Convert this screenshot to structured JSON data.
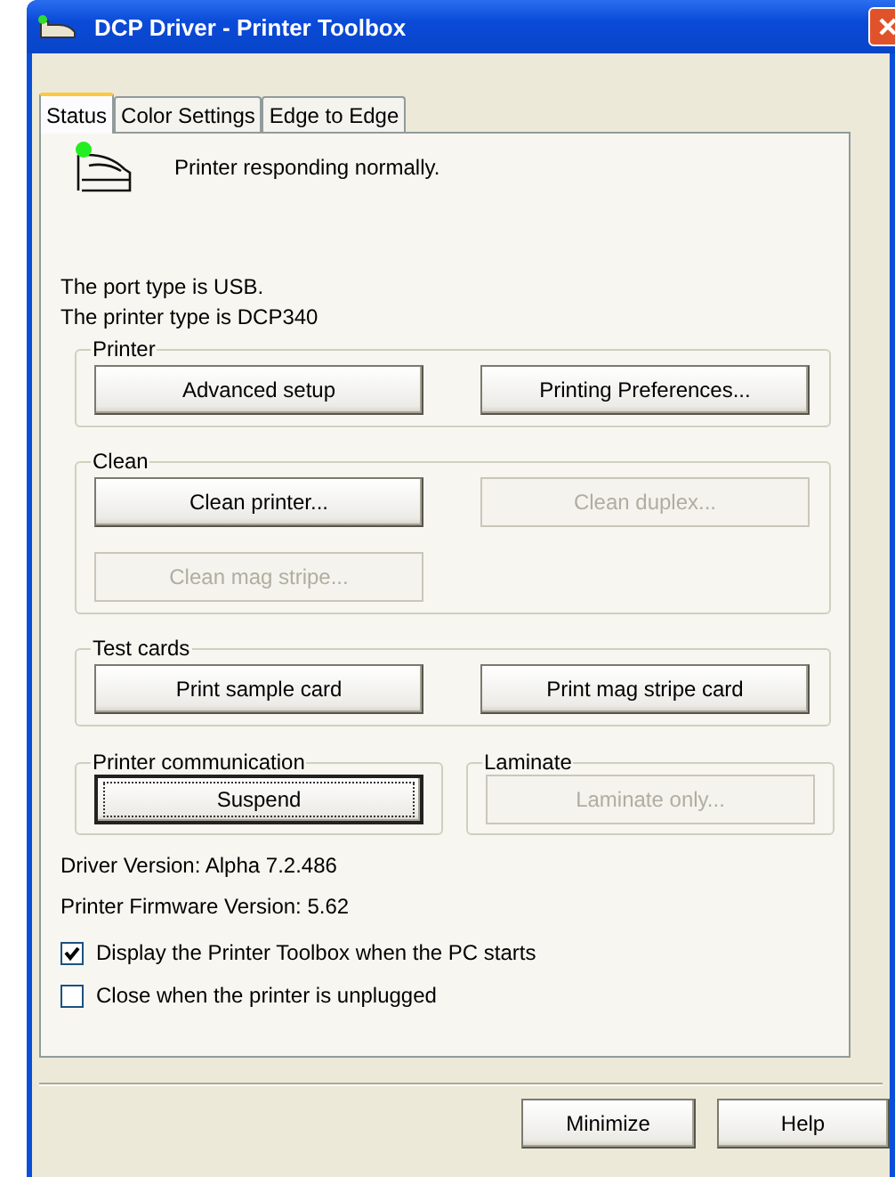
{
  "window": {
    "title": "DCP Driver - Printer Toolbox"
  },
  "tabs": [
    {
      "label": "Status",
      "selected": true
    },
    {
      "label": "Color Settings",
      "selected": false
    },
    {
      "label": "Edge to Edge",
      "selected": false
    }
  ],
  "status": {
    "message": "Printer responding normally."
  },
  "info": [
    "The port type is USB.",
    "The printer type is DCP340"
  ],
  "groups": [
    {
      "title": "Printer",
      "buttons": [
        {
          "label": "Advanced setup",
          "disabled": false,
          "focused": false
        },
        {
          "label": "Printing Preferences...",
          "disabled": false,
          "focused": false
        }
      ]
    },
    {
      "title": "Clean",
      "buttons": [
        {
          "label": "Clean printer...",
          "disabled": false,
          "focused": false
        },
        {
          "label": "Clean duplex...",
          "disabled": true,
          "focused": false
        },
        {
          "label": "Clean mag stripe...",
          "disabled": true,
          "focused": false
        }
      ]
    },
    {
      "title": "Test cards",
      "buttons": [
        {
          "label": "Print sample card",
          "disabled": false,
          "focused": false
        },
        {
          "label": "Print mag stripe card",
          "disabled": false,
          "focused": false
        }
      ]
    }
  ],
  "half_groups": [
    {
      "title": "Printer communication",
      "buttons": [
        {
          "label": "Suspend",
          "disabled": false,
          "focused": true
        }
      ]
    },
    {
      "title": "Laminate",
      "buttons": [
        {
          "label": "Laminate only...",
          "disabled": true,
          "focused": false
        }
      ]
    }
  ],
  "versions": [
    "Driver Version: Alpha 7.2.486",
    "Printer Firmware Version: 5.62"
  ],
  "checkboxes": [
    {
      "label": "Display the Printer Toolbox when the PC starts",
      "checked": true
    },
    {
      "label": "Close when the printer is unplugged",
      "checked": false
    }
  ],
  "footer_buttons": [
    "Minimize",
    "Help"
  ]
}
